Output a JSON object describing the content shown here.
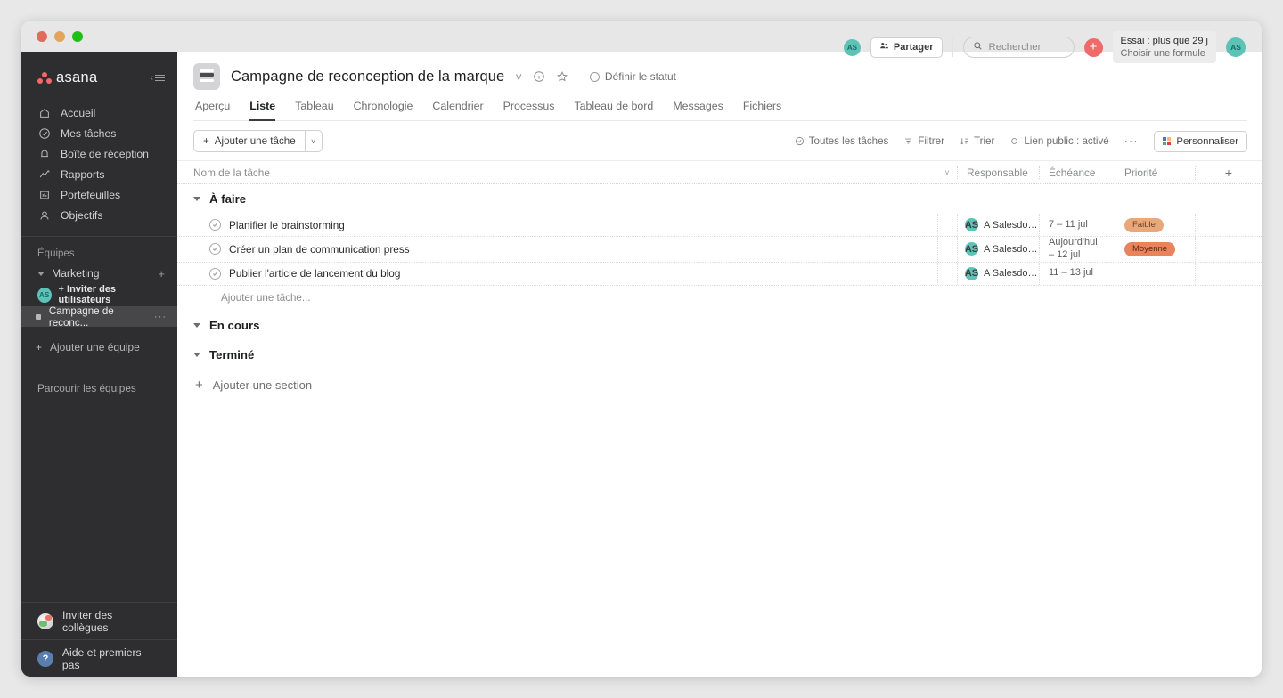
{
  "window": {
    "traffic_lights": [
      "close",
      "minimize",
      "maximize"
    ]
  },
  "sidebar": {
    "brand": "asana",
    "collapse_icon": "collapse-sidebar-icon",
    "nav": [
      {
        "label": "Accueil",
        "icon": "home-icon"
      },
      {
        "label": "Mes tâches",
        "icon": "check-circle-icon"
      },
      {
        "label": "Boîte de réception",
        "icon": "bell-icon"
      },
      {
        "label": "Rapports",
        "icon": "chart-line-icon"
      },
      {
        "label": "Portefeuilles",
        "icon": "portfolio-icon"
      },
      {
        "label": "Objectifs",
        "icon": "goal-icon"
      }
    ],
    "teams_heading": "Équipes",
    "team": {
      "name": "Marketing",
      "add_label": "+"
    },
    "invite_users": {
      "label": "Inviter des utilisateurs",
      "avatar": "AS"
    },
    "project": {
      "label": "Campagne de reconc...",
      "menu": "···"
    },
    "add_team": "Ajouter une équipe",
    "browse_teams": "Parcourir les équipes",
    "bottom": [
      {
        "label": "Inviter des collègues",
        "icon": "globe-icon"
      },
      {
        "label": "Aide et premiers pas",
        "icon": "question-mark-icon"
      }
    ]
  },
  "header": {
    "project_icon": "project-board-icon",
    "title": "Campagne de reconception de la marque",
    "title_caret": "chevron-down-icon",
    "info_icon": "info-circle-icon",
    "star_icon": "star-icon",
    "set_status": "Définir le statut",
    "tabs": [
      {
        "label": "Aperçu",
        "active": false
      },
      {
        "label": "Liste",
        "active": true
      },
      {
        "label": "Tableau",
        "active": false
      },
      {
        "label": "Chronologie",
        "active": false
      },
      {
        "label": "Calendrier",
        "active": false
      },
      {
        "label": "Processus",
        "active": false
      },
      {
        "label": "Tableau de bord",
        "active": false
      },
      {
        "label": "Messages",
        "active": false
      },
      {
        "label": "Fichiers",
        "active": false
      }
    ]
  },
  "topbar": {
    "member_avatar": "AS",
    "share_label": "Partager",
    "share_icon": "share-people-icon",
    "search_placeholder": "Rechercher",
    "search_icon": "search-icon",
    "add_button": "+",
    "trial": {
      "line1": "Essai : plus que 29 j",
      "line2": "Choisir une formule"
    },
    "user_avatar": "AS"
  },
  "toolbar": {
    "add_task_label": "Ajouter une tâche",
    "add_task_caret": "chevron-down-icon",
    "filters": [
      {
        "label": "Toutes les tâches",
        "icon": "circle-check-icon"
      },
      {
        "label": "Filtrer",
        "icon": "filter-icon"
      },
      {
        "label": "Trier",
        "icon": "sort-icon"
      },
      {
        "label": "Lien public : activé",
        "icon": "link-icon"
      }
    ],
    "more_icon": "···",
    "customize_label": "Personnaliser",
    "customize_icon": "grid-color-icon"
  },
  "table": {
    "columns": {
      "name": "Nom de la tâche",
      "assignee": "Responsable",
      "due": "Échéance",
      "priority": "Priorité",
      "add": "+"
    },
    "sections": [
      {
        "title": "À faire",
        "collapsed": false,
        "tasks": [
          {
            "name": "Planifier le brainstorming",
            "assignee": "A Salesdora...",
            "avatar": "AS",
            "due": [
              "7 – 11 jul"
            ],
            "priority": {
              "label": "Faible",
              "bg": "#e8a87c",
              "fg": "#6b4526"
            }
          },
          {
            "name": "Créer un plan de communication press",
            "assignee": "A Salesdora...",
            "avatar": "AS",
            "due": [
              "Aujourd'hui",
              "– 12 jul"
            ],
            "priority": {
              "label": "Moyenne",
              "bg": "#e8835c",
              "fg": "#5e2a12"
            }
          },
          {
            "name": "Publier l'article de lancement du blog",
            "assignee": "A Salesdora...",
            "avatar": "AS",
            "due": [
              "11 – 13 jul"
            ],
            "priority": {
              "label": "",
              "bg": "transparent",
              "fg": "transparent"
            }
          }
        ],
        "add_task_inline": "Ajouter une tâche..."
      },
      {
        "title": "En cours",
        "collapsed": true,
        "tasks": [],
        "add_task_inline": ""
      },
      {
        "title": "Terminé",
        "collapsed": true,
        "tasks": [],
        "add_task_inline": ""
      }
    ],
    "add_section": "Ajouter une section"
  },
  "colors": {
    "accent": "#f06a6a",
    "avatar": "#5cc3b6",
    "sidebar_bg": "#2e2e30"
  }
}
